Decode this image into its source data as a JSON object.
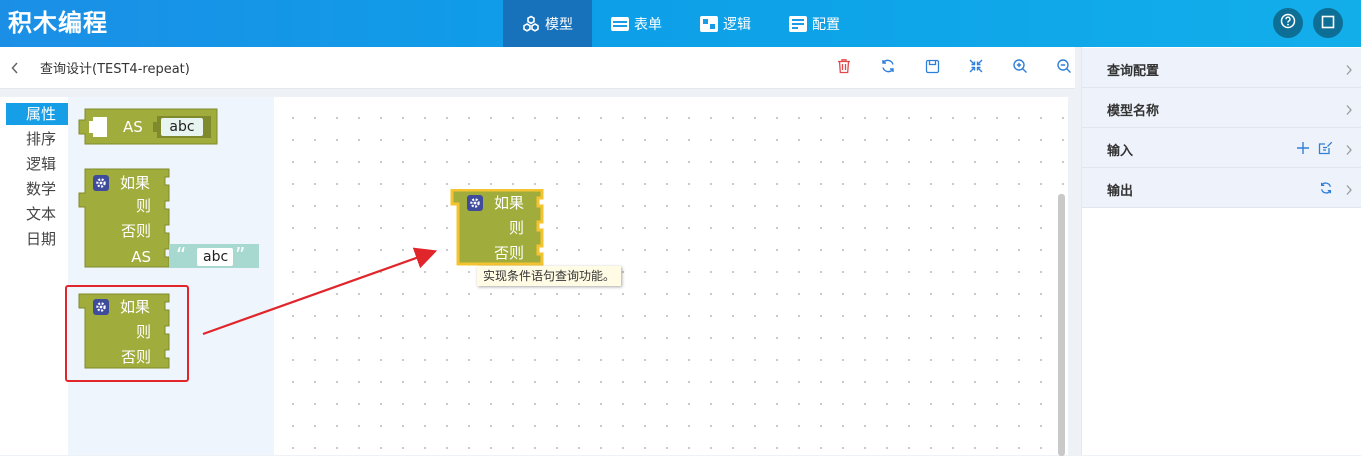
{
  "app": {
    "title": "积木编程"
  },
  "nav": {
    "tabs": [
      {
        "label": "模型",
        "icon": "cubes-icon",
        "active": true
      },
      {
        "label": "表单",
        "icon": "form-icon",
        "active": false
      },
      {
        "label": "逻辑",
        "icon": "logic-icon",
        "active": false
      },
      {
        "label": "配置",
        "icon": "config-icon",
        "active": false
      }
    ]
  },
  "header_actions": [
    "help-icon",
    "fullscreen-icon"
  ],
  "subheader": {
    "title": "查询设计(TEST4-repeat)",
    "tools": [
      "delete-icon",
      "refresh-icon",
      "save-icon",
      "collapse-icon",
      "zoom-in-icon",
      "zoom-out-icon"
    ]
  },
  "toolbox": {
    "categories": [
      "属性",
      "排序",
      "逻辑",
      "数学",
      "文本",
      "日期"
    ],
    "active_index": 0
  },
  "blocks": {
    "as_block": {
      "keyword": "AS",
      "value": "abc"
    },
    "if_block_full": {
      "if": "如果",
      "then": "则",
      "else": "否则",
      "as": "AS",
      "value": "abc"
    },
    "if_block_simple": {
      "if": "如果",
      "then": "则",
      "else": "否则"
    },
    "canvas_if_block": {
      "if": "如果",
      "then": "则",
      "else": "否则"
    }
  },
  "tooltip": {
    "text": "实现条件语句查询功能。"
  },
  "right_panel": {
    "items": [
      {
        "label": "查询配置"
      },
      {
        "label": "模型名称"
      },
      {
        "label": "输入"
      },
      {
        "label": "输出"
      }
    ]
  },
  "colors": {
    "block_fill": "#a0ad3c",
    "block_edge": "#7e8a2c",
    "block_highlight": "#f4c430",
    "text_block": "#a8d9d0",
    "accent": "#169fe6"
  }
}
